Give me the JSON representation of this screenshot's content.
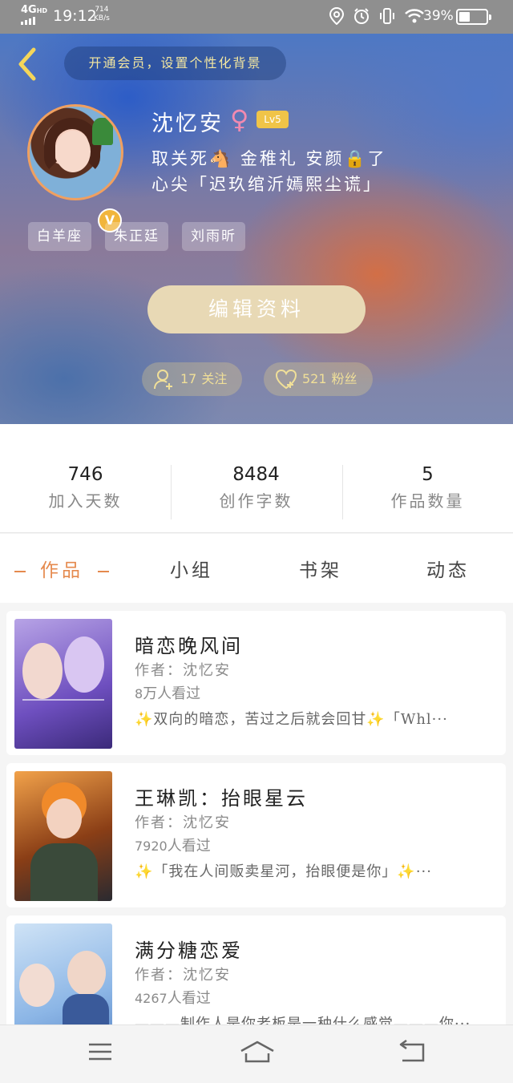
{
  "status_bar": {
    "network": "4G",
    "network_sup": "HD",
    "time": "19:12",
    "speed_value": "714",
    "speed_unit": "KB/s",
    "battery_pct": "39%",
    "battery_level": 0.39
  },
  "header": {
    "vip_prompt": "开通会员，设置个性化背景",
    "username": "沈忆安",
    "gender_symbol": "♀",
    "level": "Lv5",
    "verified_badge": "V",
    "bio_line1": "取关死🐴 金稚礼 安颜🔒了",
    "bio_line2": "心尖「迟玖绾沂嫣熙尘谎」",
    "tags": [
      "白羊座",
      "朱正廷",
      "刘雨昕"
    ],
    "edit_button": "编辑资料",
    "following_count": "17",
    "following_label": "关注",
    "followers_count": "521",
    "followers_label": "粉丝"
  },
  "stats": [
    {
      "value": "746",
      "label": "加入天数"
    },
    {
      "value": "8484",
      "label": "创作字数"
    },
    {
      "value": "5",
      "label": "作品数量"
    }
  ],
  "tabs": [
    {
      "label": "作品",
      "active": true
    },
    {
      "label": "小组",
      "active": false
    },
    {
      "label": "书架",
      "active": false
    },
    {
      "label": "动态",
      "active": false
    }
  ],
  "works": [
    {
      "title": "暗恋晚风间",
      "author": "作者：沈忆安",
      "views_num": "8",
      "views_suffix": "万人看过",
      "desc": "✨双向的暗恋，苦过之后就会回甘✨「Whl···"
    },
    {
      "title": "王琳凯：抬眼星云",
      "author": "作者：沈忆安",
      "views_num": "7920",
      "views_suffix": "人看过",
      "desc": "✨「我在人间贩卖星河，抬眼便是你」✨···"
    },
    {
      "title": "满分糖恋爱",
      "author": "作者：沈忆安",
      "views_num": "4267",
      "views_suffix": "人看过",
      "desc": "———制作人是你老板是一种什么感觉———你···"
    }
  ],
  "colors": {
    "accent": "#e58a4e",
    "gold": "#f0df98",
    "edit_button_bg": "#e8d9b5"
  },
  "icons": [
    "back-icon",
    "location-icon",
    "alarm-icon",
    "vibrate-icon",
    "wifi-icon",
    "battery-icon",
    "add-user-icon",
    "heart-icon",
    "menu-icon",
    "home-icon",
    "return-icon"
  ]
}
